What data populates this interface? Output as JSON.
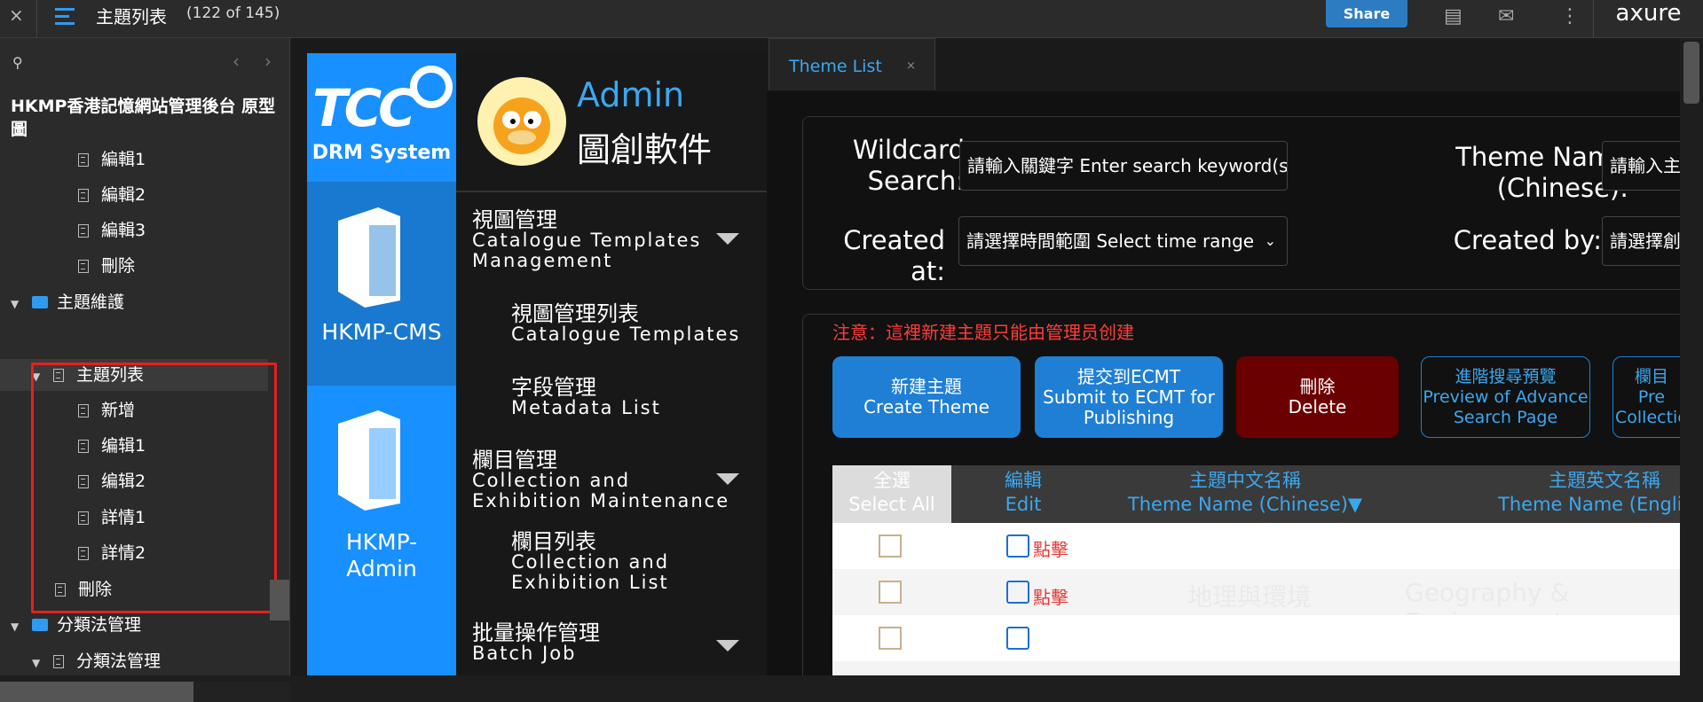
{
  "topbar": {
    "close": "×",
    "title": "主題列表",
    "count": "(122 of 145)",
    "share": "Share",
    "logo": "axure"
  },
  "sidebar": {
    "search_icon": "search-icon",
    "project": "HKMP香港記憶網站管理後台 原型圖",
    "items": [
      {
        "label": "編輯1",
        "type": "page"
      },
      {
        "label": "編輯2",
        "type": "page"
      },
      {
        "label": "編輯3",
        "type": "page"
      },
      {
        "label": "刪除",
        "type": "page"
      },
      {
        "label": "主題維護",
        "type": "folder"
      },
      {
        "label": "主題列表",
        "type": "page"
      },
      {
        "label": "新增",
        "type": "page"
      },
      {
        "label": "编辑1",
        "type": "page"
      },
      {
        "label": "编辑2",
        "type": "page"
      },
      {
        "label": "詳情1",
        "type": "page"
      },
      {
        "label": "詳情2",
        "type": "page"
      },
      {
        "label": "刪除",
        "type": "page"
      },
      {
        "label": "分類法管理",
        "type": "folder"
      },
      {
        "label": "分類法管理",
        "type": "page"
      }
    ]
  },
  "app": {
    "drm": "DRM System",
    "cms": "HKMP-CMS",
    "admin_system_1": "HKMP-",
    "admin_system_2": "Admin",
    "user_role": "Admin",
    "company": "圖創軟件",
    "menu": {
      "m1_zh": "視圖管理",
      "m1_en1": "Catalogue Templates",
      "m1_en2": "Management",
      "m1a_zh": "視圖管理列表",
      "m1a_en": "Catalogue Templates",
      "m1b_zh": "字段管理",
      "m1b_en": "Metadata List",
      "m2_zh": "欄目管理",
      "m2_en1": "Collection and",
      "m2_en2": "Exhibition Maintenance",
      "m2a_zh": "欄目列表",
      "m2a_en1": "Collection and",
      "m2a_en2": "Exhibition List",
      "m3_zh": "批量操作管理",
      "m3_en": "Batch Job"
    },
    "tab": "Theme List",
    "search": {
      "wildcard_1": "Wildcard",
      "wildcard_2": "Search:",
      "wildcard_placeholder": "請輸入關鍵字 Enter search keyword(s)",
      "theme_name_1": "Theme Name",
      "theme_name_2": "(Chinese):",
      "theme_name_placeholder": "請輸入主題",
      "created_at": "Created at:",
      "created_at_placeholder": "請選擇時間範圍 Select time range",
      "created_by": "Created by:",
      "created_by_placeholder": "請選擇創"
    },
    "notice": "注意：這裡新建主題只能由管理员创建",
    "buttons": {
      "create_zh": "新建主題",
      "create_en": "Create Theme",
      "submit_zh": "提交到ECMT",
      "submit_en1": "Submit to ECMT for",
      "submit_en2": "Publishing",
      "delete_zh": "刪除",
      "delete_en": "Delete",
      "preview_zh": "進階搜尋預覽",
      "preview_en1": "Preview of Advance",
      "preview_en2": "Search Page",
      "col_zh": "欄目",
      "col_en1": "Pre",
      "col_en2": "Collectio"
    },
    "table": {
      "select_all_zh": "全選",
      "select_all_en": "Select All",
      "edit_zh": "編輯",
      "edit_en": "Edit",
      "name_zh_zh": "主題中文名稱",
      "name_zh_en": "Theme Name (Chinese)▼",
      "name_en_zh": "主題英文名稱",
      "name_en_en": "Theme Name (English)",
      "click": "點擊",
      "row2_zh": "地理與環境",
      "row2_en": "Geography & Environment"
    }
  },
  "colors": {
    "accent": "#1890ff",
    "link": "#3aa8f0",
    "danger": "#e53935",
    "delete_btn": "#6b0000",
    "primary_btn": "#1f7fd4"
  }
}
